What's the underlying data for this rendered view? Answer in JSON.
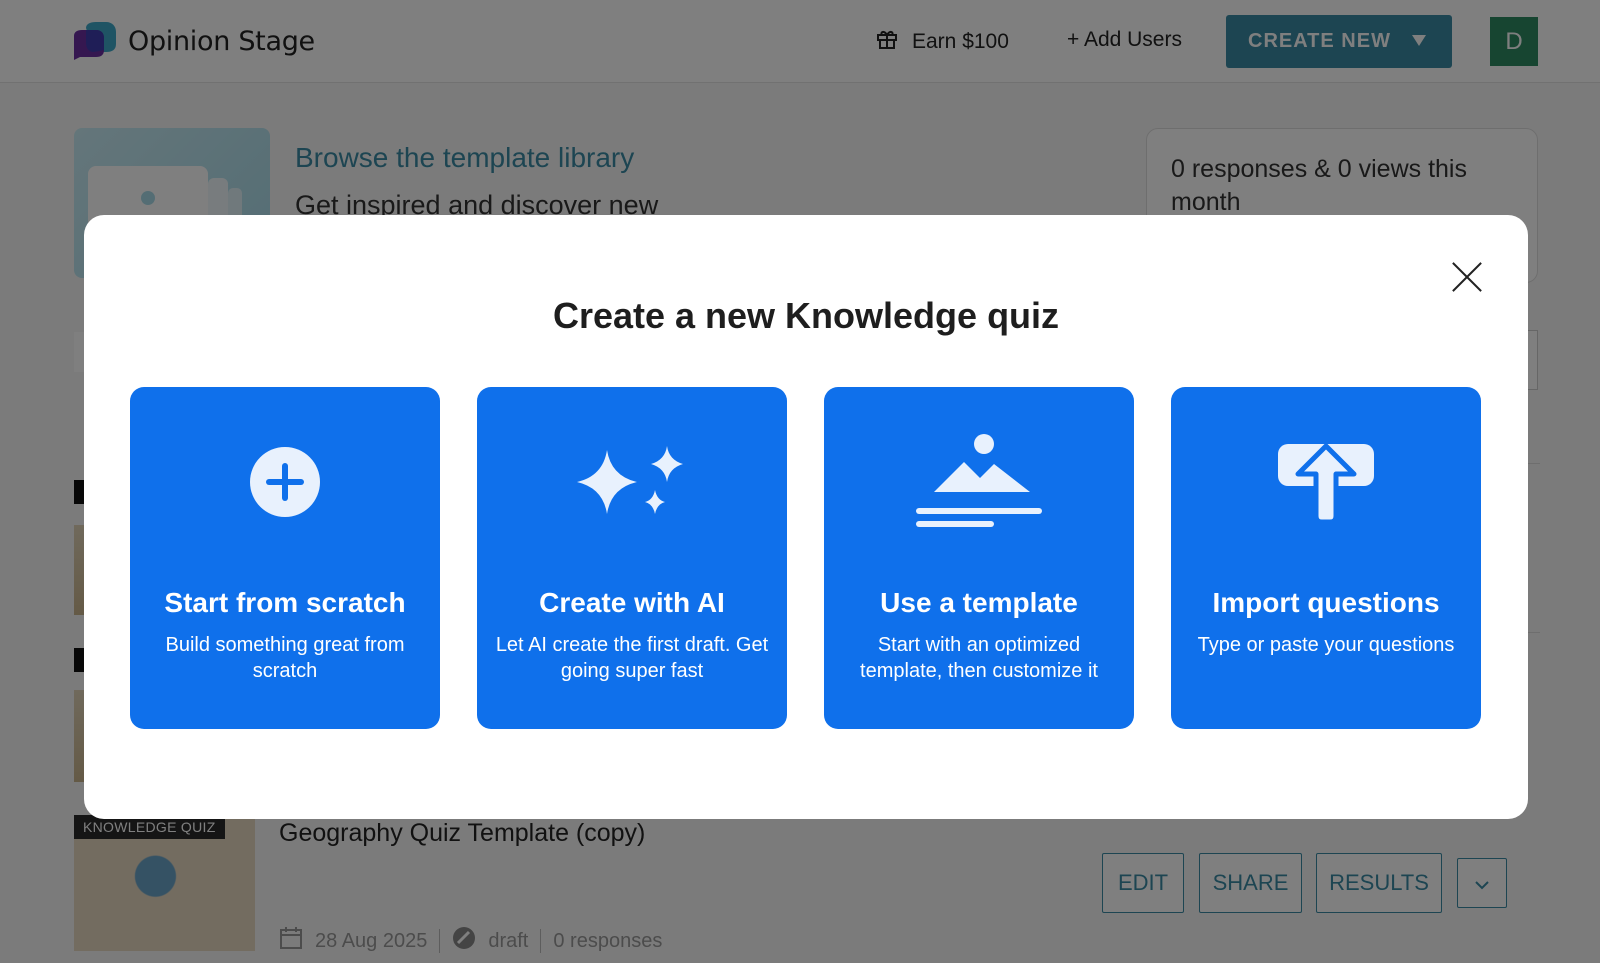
{
  "header": {
    "app_name": "Opinion Stage",
    "earn_label": "Earn $100",
    "add_users_label": "+ Add Users",
    "create_new_label": "CREATE NEW",
    "avatar_letter": "D"
  },
  "promo": {
    "title": "Browse the template library",
    "subtitle": "Get inspired and discover new"
  },
  "stats": {
    "text": "0 responses & 0 views this month"
  },
  "quiz_row": {
    "tag": "KNOWLEDGE QUIZ",
    "title": "Geography Quiz Template (copy)",
    "date": "28 Aug 2025",
    "status": "draft",
    "responses": "0 responses",
    "edit_label": "EDIT",
    "share_label": "SHARE",
    "results_label": "RESULTS"
  },
  "modal": {
    "title": "Create a new Knowledge quiz",
    "cards": [
      {
        "icon": "plus-circle-icon",
        "title": "Start from scratch",
        "desc": "Build something great from scratch"
      },
      {
        "icon": "sparkles-icon",
        "title": "Create with AI",
        "desc": "Let AI create the first draft. Get going super fast"
      },
      {
        "icon": "template-landscape-icon",
        "title": "Use a template",
        "desc": "Start with an optimized template, then customize it"
      },
      {
        "icon": "upload-cloud-icon",
        "title": "Import questions",
        "desc": "Type or paste your questions"
      }
    ]
  },
  "colors": {
    "card_blue": "#0f70eb",
    "brand_teal": "#3a8ba4",
    "avatar_green": "#2e8a63"
  }
}
